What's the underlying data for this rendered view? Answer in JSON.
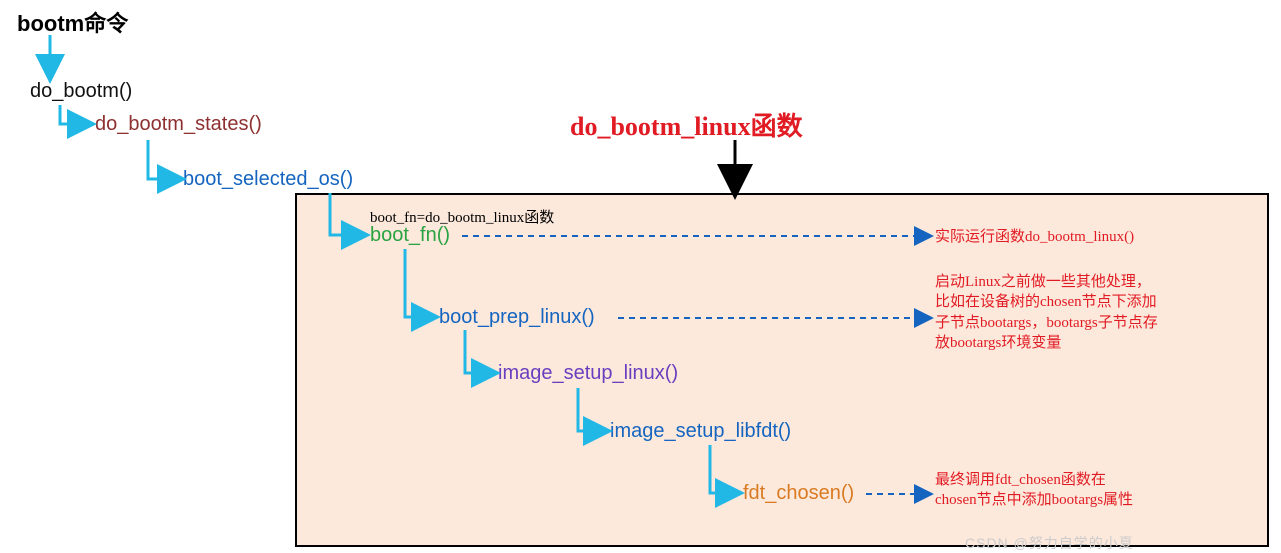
{
  "title": "bootm命令",
  "boxTitle": "do_bootm_linux函数",
  "watermark": "CSDN @努力自学的小夏",
  "note": "boot_fn=do_bootm_linux函数",
  "fn": {
    "do_bootm": "do_bootm()",
    "do_bootm_states": "do_bootm_states()",
    "boot_selected_os": "boot_selected_os()",
    "boot_fn": "boot_fn()",
    "boot_prep_linux": "boot_prep_linux()",
    "image_setup_linux": "image_setup_linux()",
    "image_setup_libfdt": "image_setup_libfdt()",
    "fdt_chosen": "fdt_chosen()"
  },
  "ann": {
    "a1": "实际运行函数do_bootm_linux()",
    "a2": "启动Linux之前做一些其他处理，比如在设备树的chosen节点下添加子节点bootargs，bootargs子节点存放bootargs环境变量",
    "a3": "最终调用fdt_chosen函数在chosen节点中添加bootargs属性"
  },
  "colors": {
    "arrowCyan": "#22b8e6",
    "arrowBlue": "#1565c0",
    "arrowBlack": "#000"
  }
}
